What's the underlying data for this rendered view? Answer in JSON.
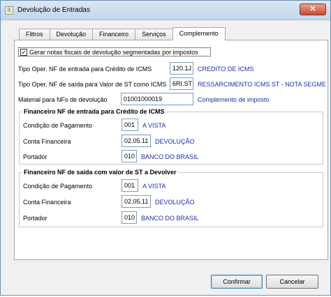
{
  "window": {
    "title": "Devolução de Entradas",
    "close_glyph": "✕"
  },
  "tabs": [
    {
      "label": "Filtros"
    },
    {
      "label": "Devolução"
    },
    {
      "label": "Financeiro"
    },
    {
      "label": "Serviços"
    },
    {
      "label": "Complemento",
      "active": true
    }
  ],
  "segmentation": {
    "label": "Gerar notas fiscais de devolução segmentadas por impostos",
    "checked": true,
    "check_glyph": "✓"
  },
  "oper_entrada": {
    "label": "Tipo Oper. NF de entrada para Crédito de ICMS",
    "value": "120.1J",
    "desc": "CREDITO DE ICMS"
  },
  "oper_saida": {
    "label": "Tipo Oper. NF de saída para Valor de ST como ICMS",
    "value": "6RI.ST",
    "desc": "RESSARCIMENTO ICMS ST - NOTA SEGME"
  },
  "material": {
    "label": "Material para NFs de devolução",
    "value": "01001000019",
    "desc": "Complemento de imposto"
  },
  "fin_entrada": {
    "title": "Financeiro NF de entrada para Crédito de  ICMS",
    "condicao": {
      "label": "Condição de Pagamento",
      "value": "001",
      "desc": "A VISTA"
    },
    "conta": {
      "label": "Conta Financeira",
      "value": "02.05.11",
      "desc": "DEVOLUÇÃO"
    },
    "portador": {
      "label": "Portador",
      "value": "010",
      "desc": "BANCO DO BRASIL"
    }
  },
  "fin_saida": {
    "title": "Financeiro NF de saída com valor de ST a Devolver",
    "condicao": {
      "label": "Condição de Pagamento",
      "value": "001",
      "desc": "A VISTA"
    },
    "conta": {
      "label": "Conta Financeira",
      "value": "02.05.11",
      "desc": "DEVOLUÇÃO"
    },
    "portador": {
      "label": "Portador",
      "value": "010",
      "desc": "BANCO DO BRASIL"
    }
  },
  "buttons": {
    "confirm": "Confirmar",
    "cancel": "Cancelar"
  },
  "colors": {
    "desc_text": "#1c2fa8",
    "field_border": "#7a9cc6",
    "close_button": "#c74a35"
  }
}
